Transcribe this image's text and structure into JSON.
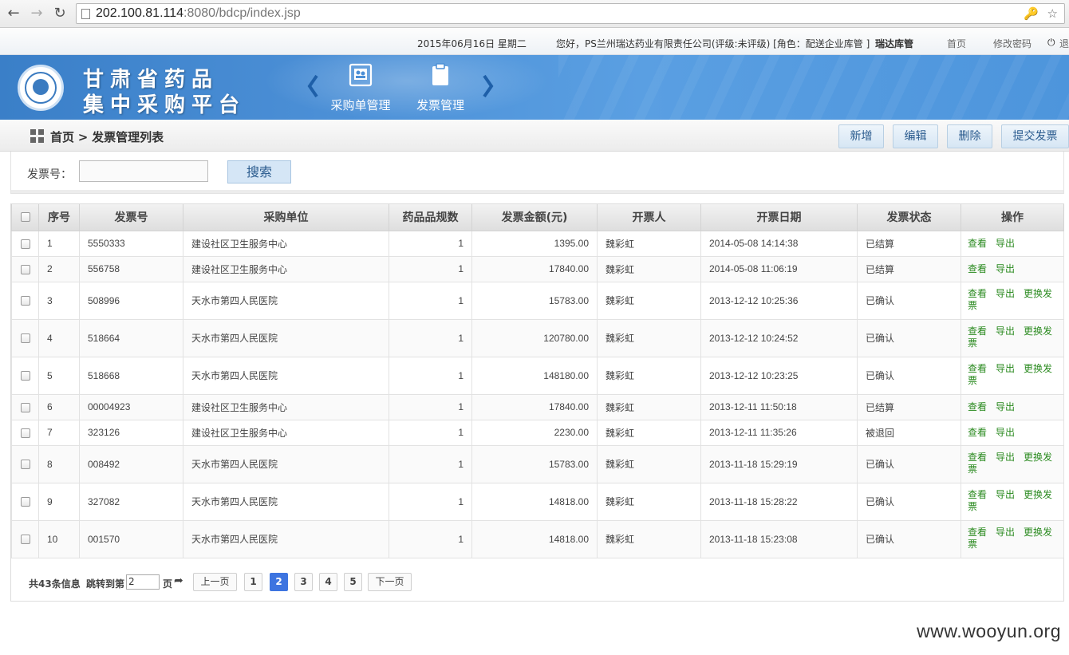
{
  "browser": {
    "url_host": "202.100.81.114",
    "url_rest": ":8080/bdcp/index.jsp"
  },
  "infobar": {
    "date": "2015年06月16日 星期二",
    "greeting": "您好，PS兰州瑞达药业有限责任公司(评级:未评级) [角色：配送企业库管 ]",
    "username": "瑞达库管",
    "home_link": "首页",
    "change_password": "修改密码",
    "logout": "退"
  },
  "banner": {
    "title_line1": "甘肃省药品",
    "title_line2": "集中采购平台",
    "tabs": [
      {
        "label": "采购单管理",
        "icon": "purchase-order-icon"
      },
      {
        "label": "发票管理",
        "icon": "clipboard-icon"
      }
    ]
  },
  "breadcrumb": {
    "home": "首页",
    "separator": ">",
    "current": "发票管理列表"
  },
  "toolbar": {
    "add": "新增",
    "edit": "编辑",
    "delete": "删除",
    "submit": "提交发票"
  },
  "search": {
    "label": "发票号：",
    "value": "",
    "button": "搜索"
  },
  "table": {
    "headers": [
      "",
      "序号",
      "发票号",
      "采购单位",
      "药品品规数",
      "发票金额(元)",
      "开票人",
      "开票日期",
      "发票状态",
      "操作"
    ],
    "rows": [
      {
        "no": "1",
        "invoice": "5550333",
        "unit": "建设社区卫生服务中心",
        "count": "1",
        "amount": "1395.00",
        "issuer": "魏彩虹",
        "date": "2014-05-08 14:14:38",
        "status": "已结算",
        "ops": [
          "查看",
          "导出"
        ]
      },
      {
        "no": "2",
        "invoice": "556758",
        "unit": "建设社区卫生服务中心",
        "count": "1",
        "amount": "17840.00",
        "issuer": "魏彩虹",
        "date": "2014-05-08 11:06:19",
        "status": "已结算",
        "ops": [
          "查看",
          "导出"
        ]
      },
      {
        "no": "3",
        "invoice": "508996",
        "unit": "天水市第四人民医院",
        "count": "1",
        "amount": "15783.00",
        "issuer": "魏彩虹",
        "date": "2013-12-12 10:25:36",
        "status": "已确认",
        "ops": [
          "查看",
          "导出",
          "更换发票"
        ]
      },
      {
        "no": "4",
        "invoice": "518664",
        "unit": "天水市第四人民医院",
        "count": "1",
        "amount": "120780.00",
        "issuer": "魏彩虹",
        "date": "2013-12-12 10:24:52",
        "status": "已确认",
        "ops": [
          "查看",
          "导出",
          "更换发票"
        ]
      },
      {
        "no": "5",
        "invoice": "518668",
        "unit": "天水市第四人民医院",
        "count": "1",
        "amount": "148180.00",
        "issuer": "魏彩虹",
        "date": "2013-12-12 10:23:25",
        "status": "已确认",
        "ops": [
          "查看",
          "导出",
          "更换发票"
        ]
      },
      {
        "no": "6",
        "invoice": "00004923",
        "unit": "建设社区卫生服务中心",
        "count": "1",
        "amount": "17840.00",
        "issuer": "魏彩虹",
        "date": "2013-12-11 11:50:18",
        "status": "已结算",
        "ops": [
          "查看",
          "导出"
        ]
      },
      {
        "no": "7",
        "invoice": "323126",
        "unit": "建设社区卫生服务中心",
        "count": "1",
        "amount": "2230.00",
        "issuer": "魏彩虹",
        "date": "2013-12-11 11:35:26",
        "status": "被退回",
        "ops": [
          "查看",
          "导出"
        ]
      },
      {
        "no": "8",
        "invoice": "008492",
        "unit": "天水市第四人民医院",
        "count": "1",
        "amount": "15783.00",
        "issuer": "魏彩虹",
        "date": "2013-11-18 15:29:19",
        "status": "已确认",
        "ops": [
          "查看",
          "导出",
          "更换发票"
        ]
      },
      {
        "no": "9",
        "invoice": "327082",
        "unit": "天水市第四人民医院",
        "count": "1",
        "amount": "14818.00",
        "issuer": "魏彩虹",
        "date": "2013-11-18 15:28:22",
        "status": "已确认",
        "ops": [
          "查看",
          "导出",
          "更换发票"
        ]
      },
      {
        "no": "10",
        "invoice": "001570",
        "unit": "天水市第四人民医院",
        "count": "1",
        "amount": "14818.00",
        "issuer": "魏彩虹",
        "date": "2013-11-18 15:23:08",
        "status": "已确认",
        "ops": [
          "查看",
          "导出",
          "更换发票"
        ]
      }
    ]
  },
  "pager": {
    "total": "共43条信息",
    "jump_prefix": "跳转到第",
    "jump_value": "2",
    "jump_suffix": "页",
    "prev": "上一页",
    "pages": [
      "1",
      "2",
      "3",
      "4",
      "5"
    ],
    "current_page": "2",
    "next": "下一页"
  },
  "watermark": "www.wooyun.org",
  "colors": {
    "banner_blue": "#4b8fd6",
    "link_green": "#2a8a1f",
    "current_page": "#3d74e0"
  }
}
